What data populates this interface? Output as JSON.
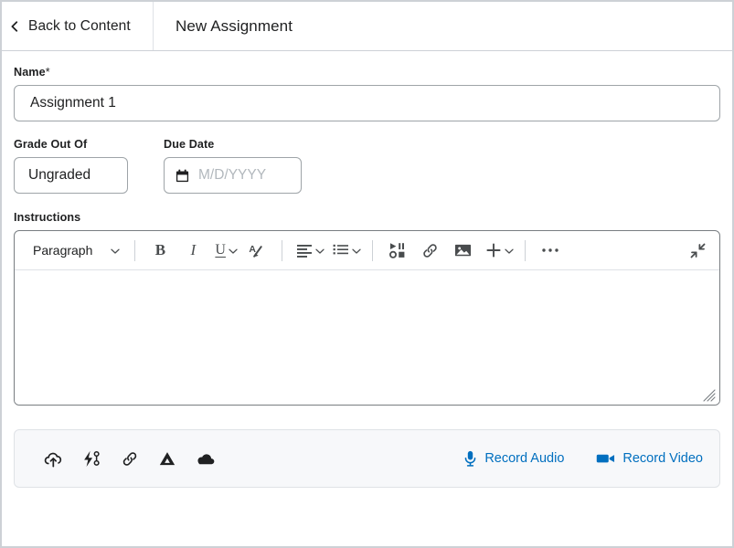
{
  "header": {
    "back_label": "Back to Content",
    "back_icon": "chevron-left-icon",
    "title": "New Assignment"
  },
  "form": {
    "name": {
      "label": "Name",
      "required_marker": "*",
      "value": "Assignment 1"
    },
    "grade_out_of": {
      "label": "Grade Out Of",
      "value": "Ungraded"
    },
    "due_date": {
      "label": "Due Date",
      "value": "",
      "placeholder": "M/D/YYYY",
      "icon": "calendar-icon"
    },
    "instructions": {
      "label": "Instructions",
      "value": ""
    }
  },
  "toolbar": {
    "paragraph_label": "Paragraph",
    "bold_label": "B",
    "italic_label": "I",
    "underline_label": "U",
    "items": [
      {
        "name": "paragraph-style-select",
        "icon": "chevron-down-icon"
      },
      {
        "name": "bold-button",
        "icon": "bold-icon"
      },
      {
        "name": "italic-button",
        "icon": "italic-icon"
      },
      {
        "name": "underline-button",
        "icon": "underline-icon"
      },
      {
        "name": "format-painter-button",
        "icon": "a-pencil-icon"
      },
      {
        "name": "align-button",
        "icon": "align-left-icon"
      },
      {
        "name": "list-button",
        "icon": "bullet-list-icon"
      },
      {
        "name": "insert-stuff-button",
        "icon": "insert-stuff-icon"
      },
      {
        "name": "insert-link-button",
        "icon": "link-icon"
      },
      {
        "name": "insert-image-button",
        "icon": "image-icon"
      },
      {
        "name": "insert-more-button",
        "icon": "plus-icon"
      },
      {
        "name": "more-options-button",
        "icon": "ellipsis-icon"
      },
      {
        "name": "fullscreen-button",
        "icon": "expand-icon"
      }
    ]
  },
  "attachments": {
    "icons": [
      {
        "name": "upload-file-icon",
        "title": "Upload"
      },
      {
        "name": "quicklink-icon",
        "title": "Quicklink"
      },
      {
        "name": "attach-link-icon",
        "title": "Link"
      },
      {
        "name": "google-drive-icon",
        "title": "Google Drive"
      },
      {
        "name": "onedrive-icon",
        "title": "OneDrive"
      }
    ],
    "record_audio_label": "Record Audio",
    "record_video_label": "Record Video"
  },
  "colors": {
    "link_blue": "#006fbf",
    "border_gray": "#cdd1d6",
    "text_dark": "#202122",
    "placeholder_gray": "#b2b8bd",
    "bar_background": "#f7f8fa"
  }
}
